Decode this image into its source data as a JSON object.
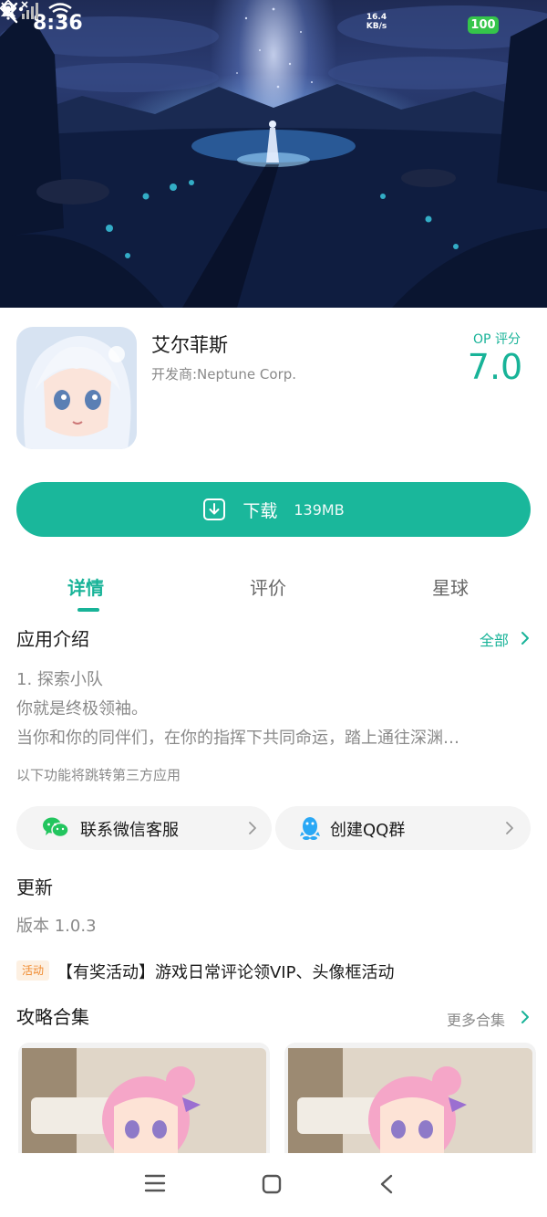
{
  "status_bar": {
    "time": "8:36",
    "net_speed_value": "16.4",
    "net_speed_unit": "KB/s",
    "battery": "100",
    "icons": [
      "dnd-icon",
      "mute-bell-icon",
      "signal-icon",
      "wifi-icon",
      "battery-icon",
      "charging-icon"
    ]
  },
  "header": {
    "back_icon": "chevron-left-icon",
    "more_icon": "more-dots-icon"
  },
  "app": {
    "name": "艾尔菲斯",
    "developer": "开发商:Neptune Corp.",
    "score_label": "OP 评分",
    "score": "7.0"
  },
  "download": {
    "label": "下载",
    "size": "139MB"
  },
  "tabs": [
    {
      "label": "详情",
      "active": true
    },
    {
      "label": "评价",
      "active": false
    },
    {
      "label": "星球",
      "active": false
    }
  ],
  "intro": {
    "title": "应用介绍",
    "all_label": "全部",
    "lines": [
      "1. 探索小队",
      "你就是终极领袖。",
      "当你和你的同伴们，在你的指挥下共同命运，踏上通往深渊…"
    ],
    "third_party_note": "以下功能将跳转第三方应用"
  },
  "contacts": [
    {
      "label": "联系微信客服",
      "icon": "wechat-icon"
    },
    {
      "label": "创建QQ群",
      "icon": "qq-penguin-icon"
    }
  ],
  "update": {
    "title": "更新",
    "version": "版本 1.0.3"
  },
  "activity": {
    "badge": "活动",
    "text": "【有奖活动】游戏日常评论领VIP、头像框活动"
  },
  "guides": {
    "title": "攻略合集",
    "more_label": "更多合集"
  },
  "colors": {
    "accent": "#1ab79b",
    "badge_bg": "#fdf0e2",
    "badge_text": "#f0892c",
    "battery": "#35c54a"
  },
  "nav_bar": {
    "icons": [
      "menu-icon",
      "home-square-icon",
      "back-triangle-icon"
    ]
  }
}
